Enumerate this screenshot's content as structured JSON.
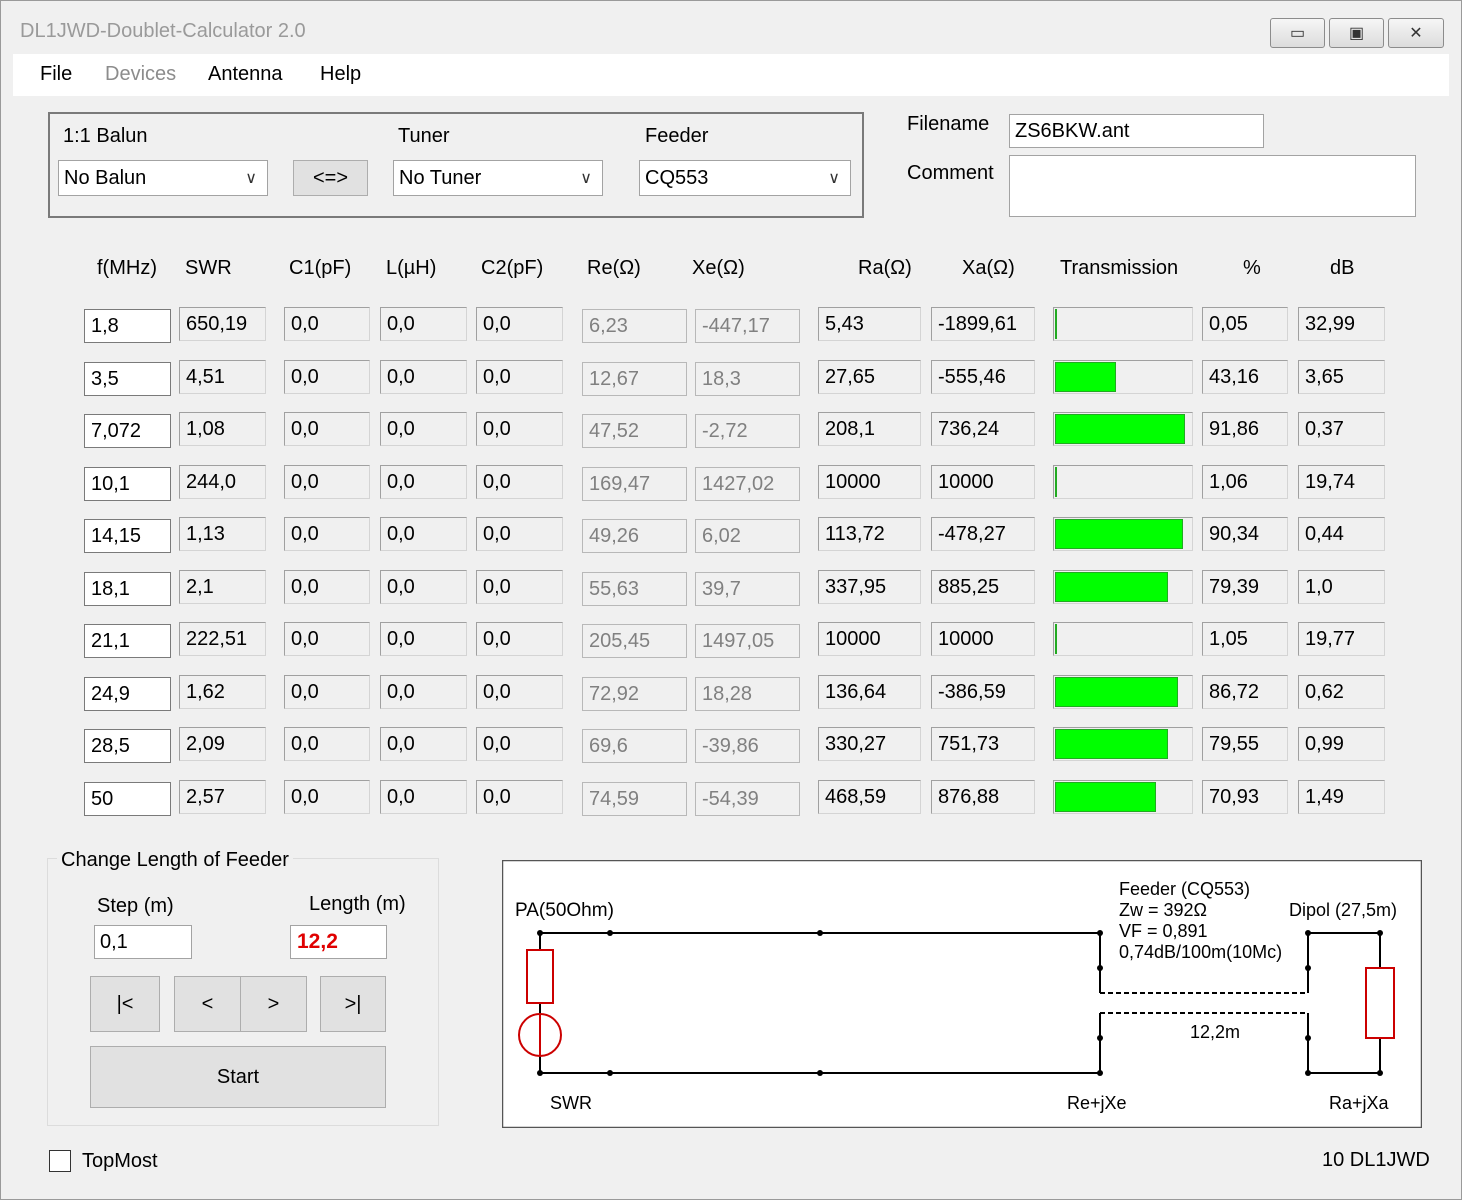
{
  "window": {
    "title": "DL1JWD-Doublet-Calculator 2.0",
    "minimize": "▭",
    "maximize": "▣",
    "close": "✕"
  },
  "menu": {
    "file": "File",
    "devices": "Devices",
    "antenna": "Antenna",
    "help": "Help"
  },
  "config": {
    "balun_label": "1:1 Balun",
    "balun_value": "No Balun",
    "swap_label": "<=>",
    "tuner_label": "Tuner",
    "tuner_value": "No Tuner",
    "feeder_label": "Feeder",
    "feeder_value": "CQ553"
  },
  "file": {
    "filename_label": "Filename",
    "filename_value": "ZS6BKW.ant",
    "comment_label": "Comment",
    "comment_value": ""
  },
  "table": {
    "headers": [
      "f(MHz)",
      "SWR",
      "C1(pF)",
      "L(µH)",
      "C2(pF)",
      "Re(Ω)",
      "Xe(Ω)",
      "Ra(Ω)",
      "Xa(Ω)",
      "Transmission",
      "%",
      "dB"
    ],
    "rows": [
      {
        "f": "1,8",
        "swr": "650,19",
        "c1": "0,0",
        "l": "0,0",
        "c2": "0,0",
        "re": "6,23",
        "xe": "-447,17",
        "ra": "5,43",
        "xa": "-1899,61",
        "pct": "0,05",
        "db": "32,99",
        "trans": 0.05
      },
      {
        "f": "3,5",
        "swr": "4,51",
        "c1": "0,0",
        "l": "0,0",
        "c2": "0,0",
        "re": "12,67",
        "xe": "18,3",
        "ra": "27,65",
        "xa": "-555,46",
        "pct": "43,16",
        "db": "3,65",
        "trans": 43.16
      },
      {
        "f": "7,072",
        "swr": "1,08",
        "c1": "0,0",
        "l": "0,0",
        "c2": "0,0",
        "re": "47,52",
        "xe": "-2,72",
        "ra": "208,1",
        "xa": "736,24",
        "pct": "91,86",
        "db": "0,37",
        "trans": 91.86
      },
      {
        "f": "10,1",
        "swr": "244,0",
        "c1": "0,0",
        "l": "0,0",
        "c2": "0,0",
        "re": "169,47",
        "xe": "1427,02",
        "ra": "10000",
        "xa": "10000",
        "pct": "1,06",
        "db": "19,74",
        "trans": 1.06
      },
      {
        "f": "14,15",
        "swr": "1,13",
        "c1": "0,0",
        "l": "0,0",
        "c2": "0,0",
        "re": "49,26",
        "xe": "6,02",
        "ra": "113,72",
        "xa": "-478,27",
        "pct": "90,34",
        "db": "0,44",
        "trans": 90.34
      },
      {
        "f": "18,1",
        "swr": "2,1",
        "c1": "0,0",
        "l": "0,0",
        "c2": "0,0",
        "re": "55,63",
        "xe": "39,7",
        "ra": "337,95",
        "xa": "885,25",
        "pct": "79,39",
        "db": "1,0",
        "trans": 79.39
      },
      {
        "f": "21,1",
        "swr": "222,51",
        "c1": "0,0",
        "l": "0,0",
        "c2": "0,0",
        "re": "205,45",
        "xe": "1497,05",
        "ra": "10000",
        "xa": "10000",
        "pct": "1,05",
        "db": "19,77",
        "trans": 1.05
      },
      {
        "f": "24,9",
        "swr": "1,62",
        "c1": "0,0",
        "l": "0,0",
        "c2": "0,0",
        "re": "72,92",
        "xe": "18,28",
        "ra": "136,64",
        "xa": "-386,59",
        "pct": "86,72",
        "db": "0,62",
        "trans": 86.72
      },
      {
        "f": "28,5",
        "swr": "2,09",
        "c1": "0,0",
        "l": "0,0",
        "c2": "0,0",
        "re": "69,6",
        "xe": "-39,86",
        "ra": "330,27",
        "xa": "751,73",
        "pct": "79,55",
        "db": "0,99",
        "trans": 79.55
      },
      {
        "f": "50",
        "swr": "2,57",
        "c1": "0,0",
        "l": "0,0",
        "c2": "0,0",
        "re": "74,59",
        "xe": "-54,39",
        "ra": "468,59",
        "xa": "876,88",
        "pct": "70,93",
        "db": "1,49",
        "trans": 70.93
      }
    ]
  },
  "feeder_length": {
    "group_title": "Change Length of Feeder",
    "step_label": "Step (m)",
    "step_value": "0,1",
    "length_label": "Length (m)",
    "length_value": "12,2",
    "btn_first": "|<",
    "btn_prev": "<",
    "btn_next": ">",
    "btn_last": ">|",
    "start": "Start"
  },
  "diagram": {
    "pa": "PA(50Ohm)",
    "feeder_title": "Feeder (CQ553)",
    "zw": "Zw = 392Ω",
    "vf": "VF = 0,891",
    "loss": "0,74dB/100m(10Mc)",
    "dipol": "Dipol (27,5m)",
    "length": "12,2m",
    "swr": "SWR",
    "re": "Re+jXe",
    "ra": "Ra+jXa"
  },
  "footer": {
    "topmost": "TopMost",
    "status": "10 DL1JWD"
  },
  "colors": {
    "bar": "#00ff00",
    "length_value": "#e00000",
    "diagram_red": "#cc0000"
  }
}
